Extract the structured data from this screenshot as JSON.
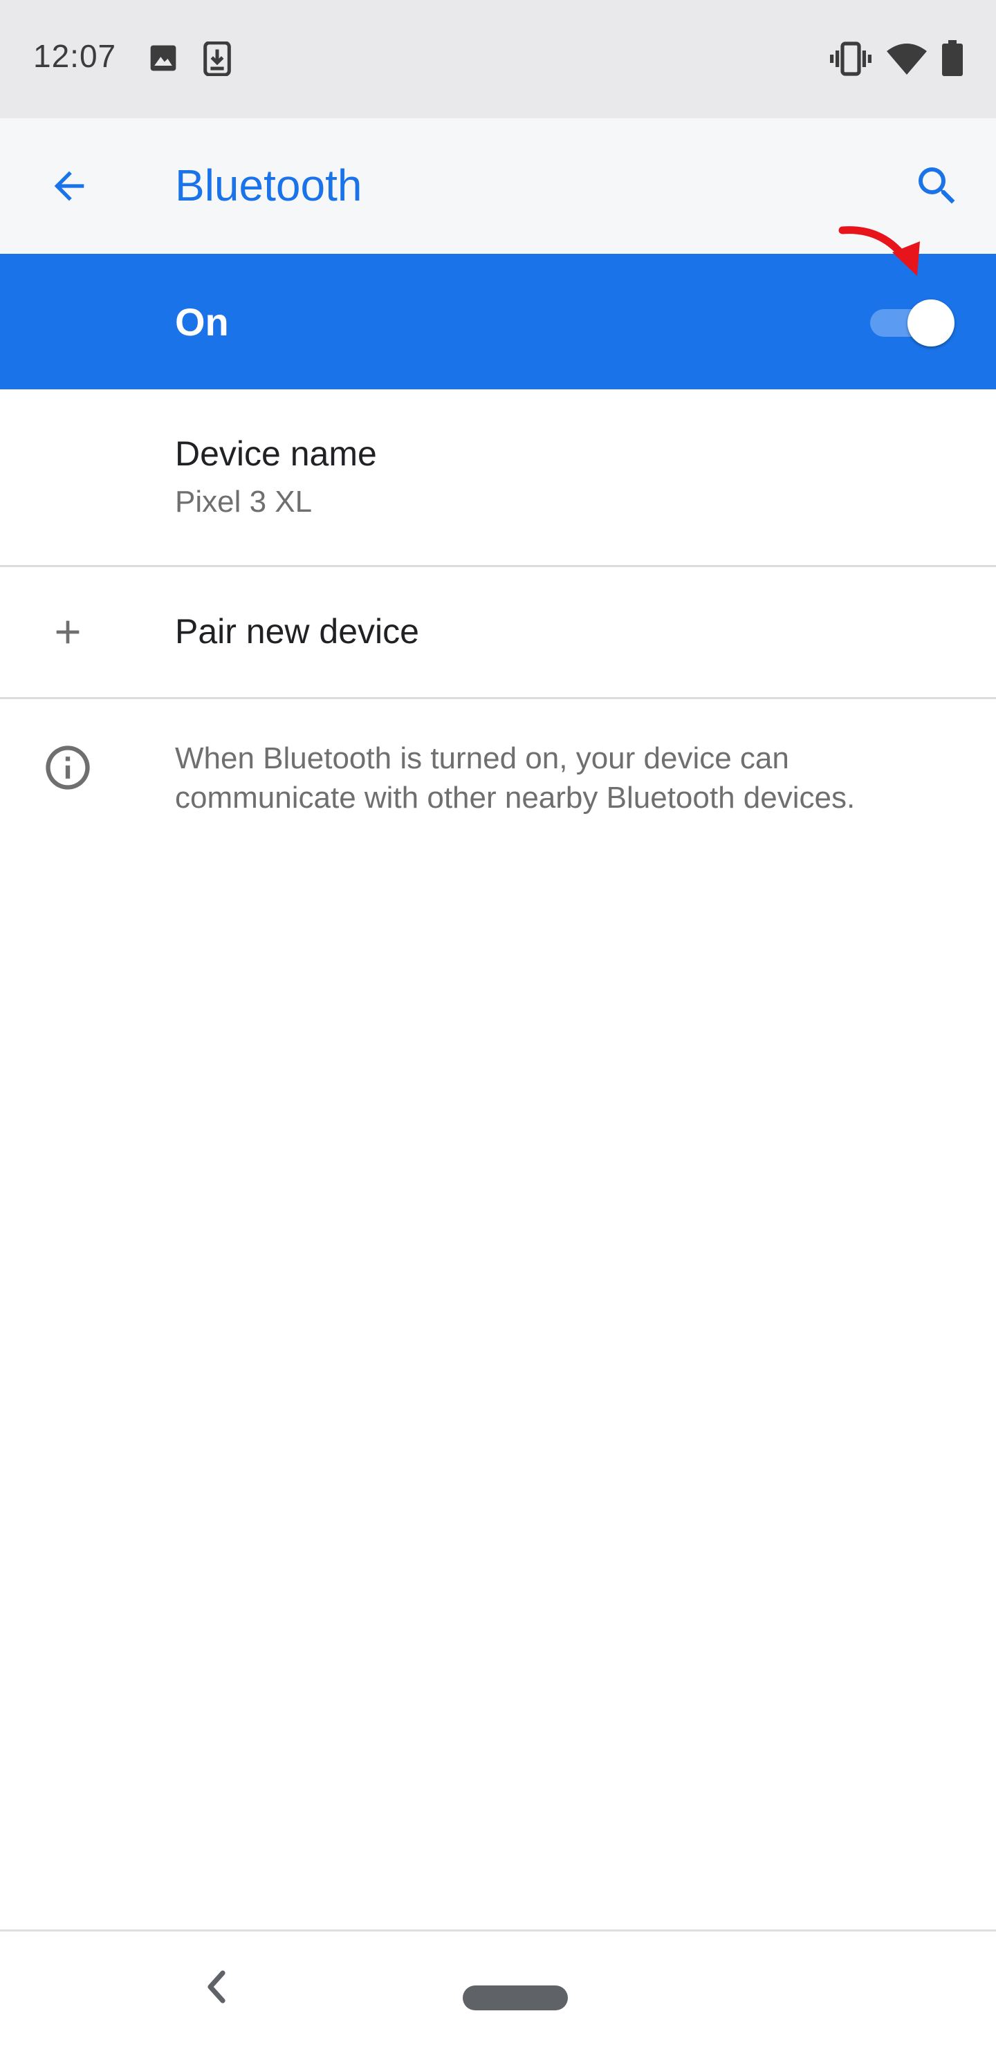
{
  "status_bar": {
    "time": "12:07",
    "icons": [
      "image-icon",
      "download-icon",
      "vibrate-icon",
      "wifi-icon",
      "battery-icon"
    ]
  },
  "app_bar": {
    "title": "Bluetooth",
    "back_icon": "arrow-back-icon",
    "search_icon": "search-icon"
  },
  "bluetooth_toggle": {
    "label": "On",
    "state": true
  },
  "device_name": {
    "title": "Device name",
    "value": "Pixel 3 XL"
  },
  "pair_new_device": {
    "label": "Pair new device",
    "icon": "plus-icon"
  },
  "info": {
    "icon": "info-icon",
    "text": "When Bluetooth is turned on, your device can communicate with other nearby Bluetooth devices."
  },
  "nav_bar": {
    "back_icon": "chevron-left-icon",
    "home_icon": "home-pill-icon"
  },
  "colors": {
    "accent": "#1a73e8",
    "annotation": "#e8141c",
    "status_bar_bg": "#e9e9ec"
  }
}
